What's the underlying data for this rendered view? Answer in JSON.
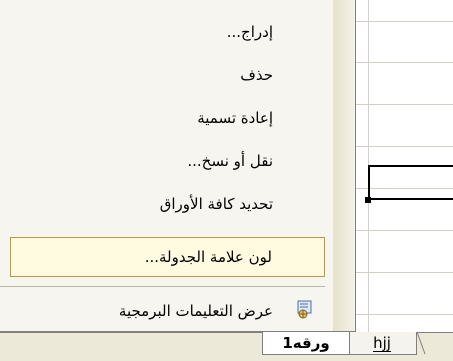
{
  "sheet": {
    "tabs": [
      {
        "label": "ورقه1",
        "active": true
      },
      {
        "label": "hjj",
        "active": false
      }
    ]
  },
  "context_menu": {
    "items": [
      {
        "label": "إدراج..."
      },
      {
        "label": "حذف"
      },
      {
        "label": "إعادة تسمية"
      },
      {
        "label": "نقل أو نسخ..."
      },
      {
        "label": "تحديد كافة الأوراق"
      },
      {
        "label": "لون علامة الجدولة...",
        "highlighted": true
      },
      {
        "label": "عرض التعليمات البرمجية",
        "icon": "code-view-icon"
      }
    ],
    "highlight_color": "#fffbe0",
    "highlight_border": "#b79c35"
  }
}
